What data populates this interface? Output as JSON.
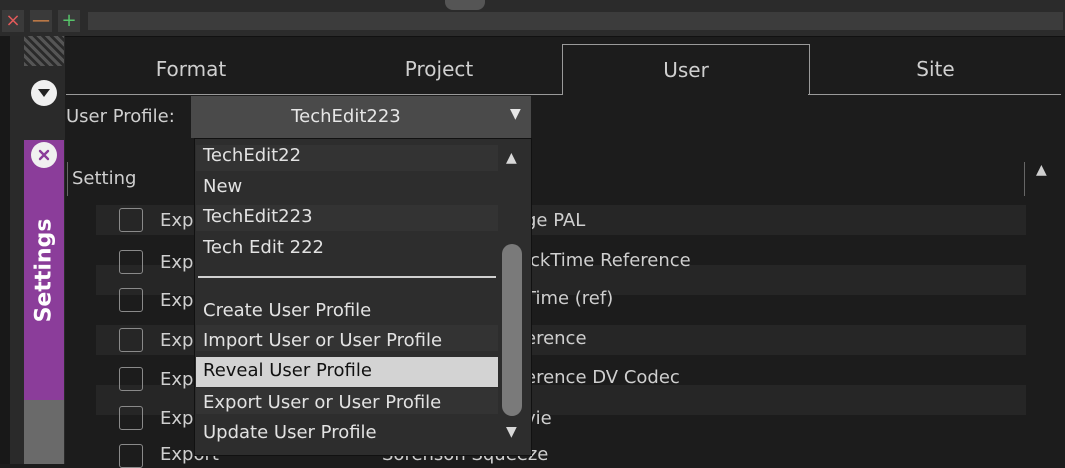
{
  "window": {
    "close_glyph": "×",
    "min_glyph": "—",
    "max_glyph": "+"
  },
  "side": {
    "settings_label": "Settings"
  },
  "tabs": [
    {
      "label": "Format"
    },
    {
      "label": "Project"
    },
    {
      "label": "User",
      "active": true
    },
    {
      "label": "Site"
    }
  ],
  "profile": {
    "label": "User Profile:",
    "value": "TechEdit223"
  },
  "settings": {
    "header": "Setting",
    "rows": [
      {
        "left": "Exp",
        "right": "ge PAL"
      },
      {
        "left": "Exp",
        "right": "ickTime Reference"
      },
      {
        "left": "Exp",
        "right": "Time (ref)"
      },
      {
        "left": "Exp",
        "right": "erence"
      },
      {
        "left": "Exp",
        "right": "erence DV Codec"
      },
      {
        "left": "Exp",
        "right": "vie"
      },
      {
        "left": "Export",
        "right": "Sorenson Squeeze"
      }
    ]
  },
  "dropdown": {
    "items": [
      "TechEdit22",
      "New",
      "TechEdit223",
      "Tech Edit 222"
    ],
    "actions": [
      "Create User Profile",
      "Import User or User Profile",
      "Reveal User Profile",
      "Export User or User Profile",
      "Update User Profile"
    ],
    "highlighted": "Reveal User Profile"
  },
  "colors": {
    "accent_purple": "#8b3d9a",
    "highlight": "#d3d3d3"
  },
  "icons": {
    "close_circle": "close-circle-icon",
    "collapse_circle": "collapse-icon",
    "dropdown_arrow": "triangle-down-icon"
  }
}
